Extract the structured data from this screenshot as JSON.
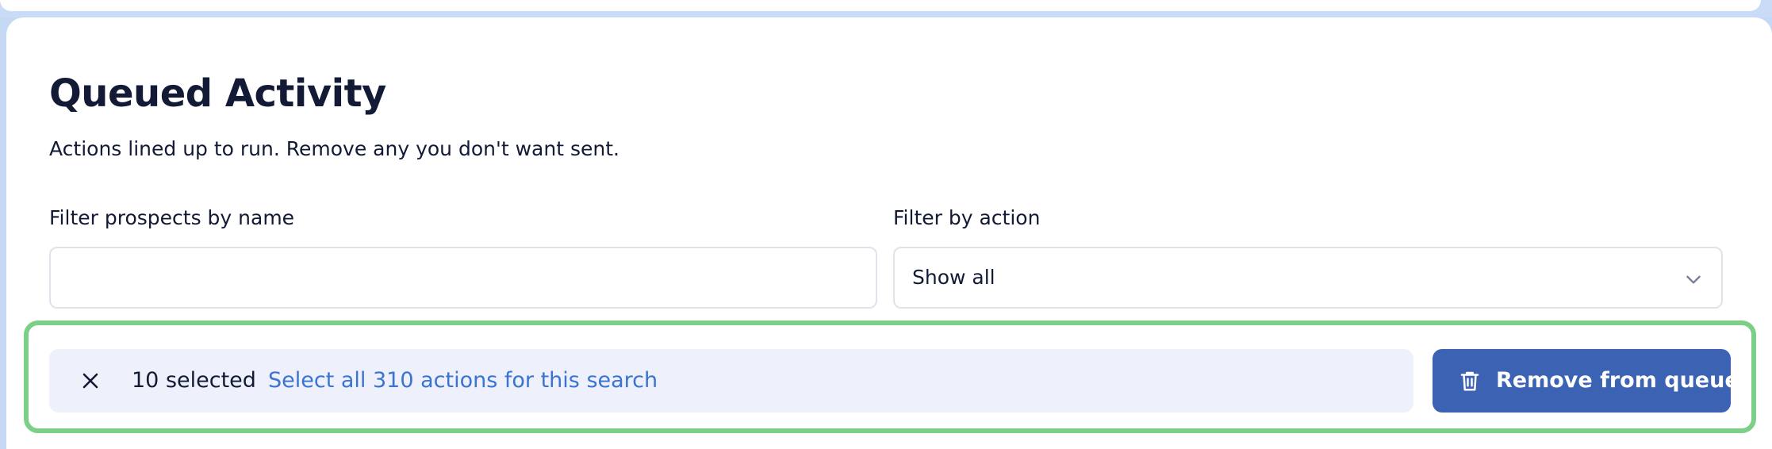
{
  "page": {
    "title": "Queued Activity",
    "subtitle": "Actions lined up to run. Remove any you don't want sent."
  },
  "filters": {
    "name_label": "Filter prospects by name",
    "name_value": "",
    "action_label": "Filter by action",
    "action_selected": "Show all"
  },
  "selection": {
    "count_text": "10 selected",
    "select_all_text": "Select all 310 actions for this search",
    "remove_label": "Remove from queue"
  },
  "icons": {
    "clear": "close-icon",
    "dropdown": "chevron-down-icon",
    "remove": "trash-icon"
  },
  "colors": {
    "accent": "#3b62b3",
    "link": "#3a74d0",
    "highlight_outline": "#7bcf86",
    "selection_bg": "#eef0fb",
    "text": "#121a35"
  }
}
